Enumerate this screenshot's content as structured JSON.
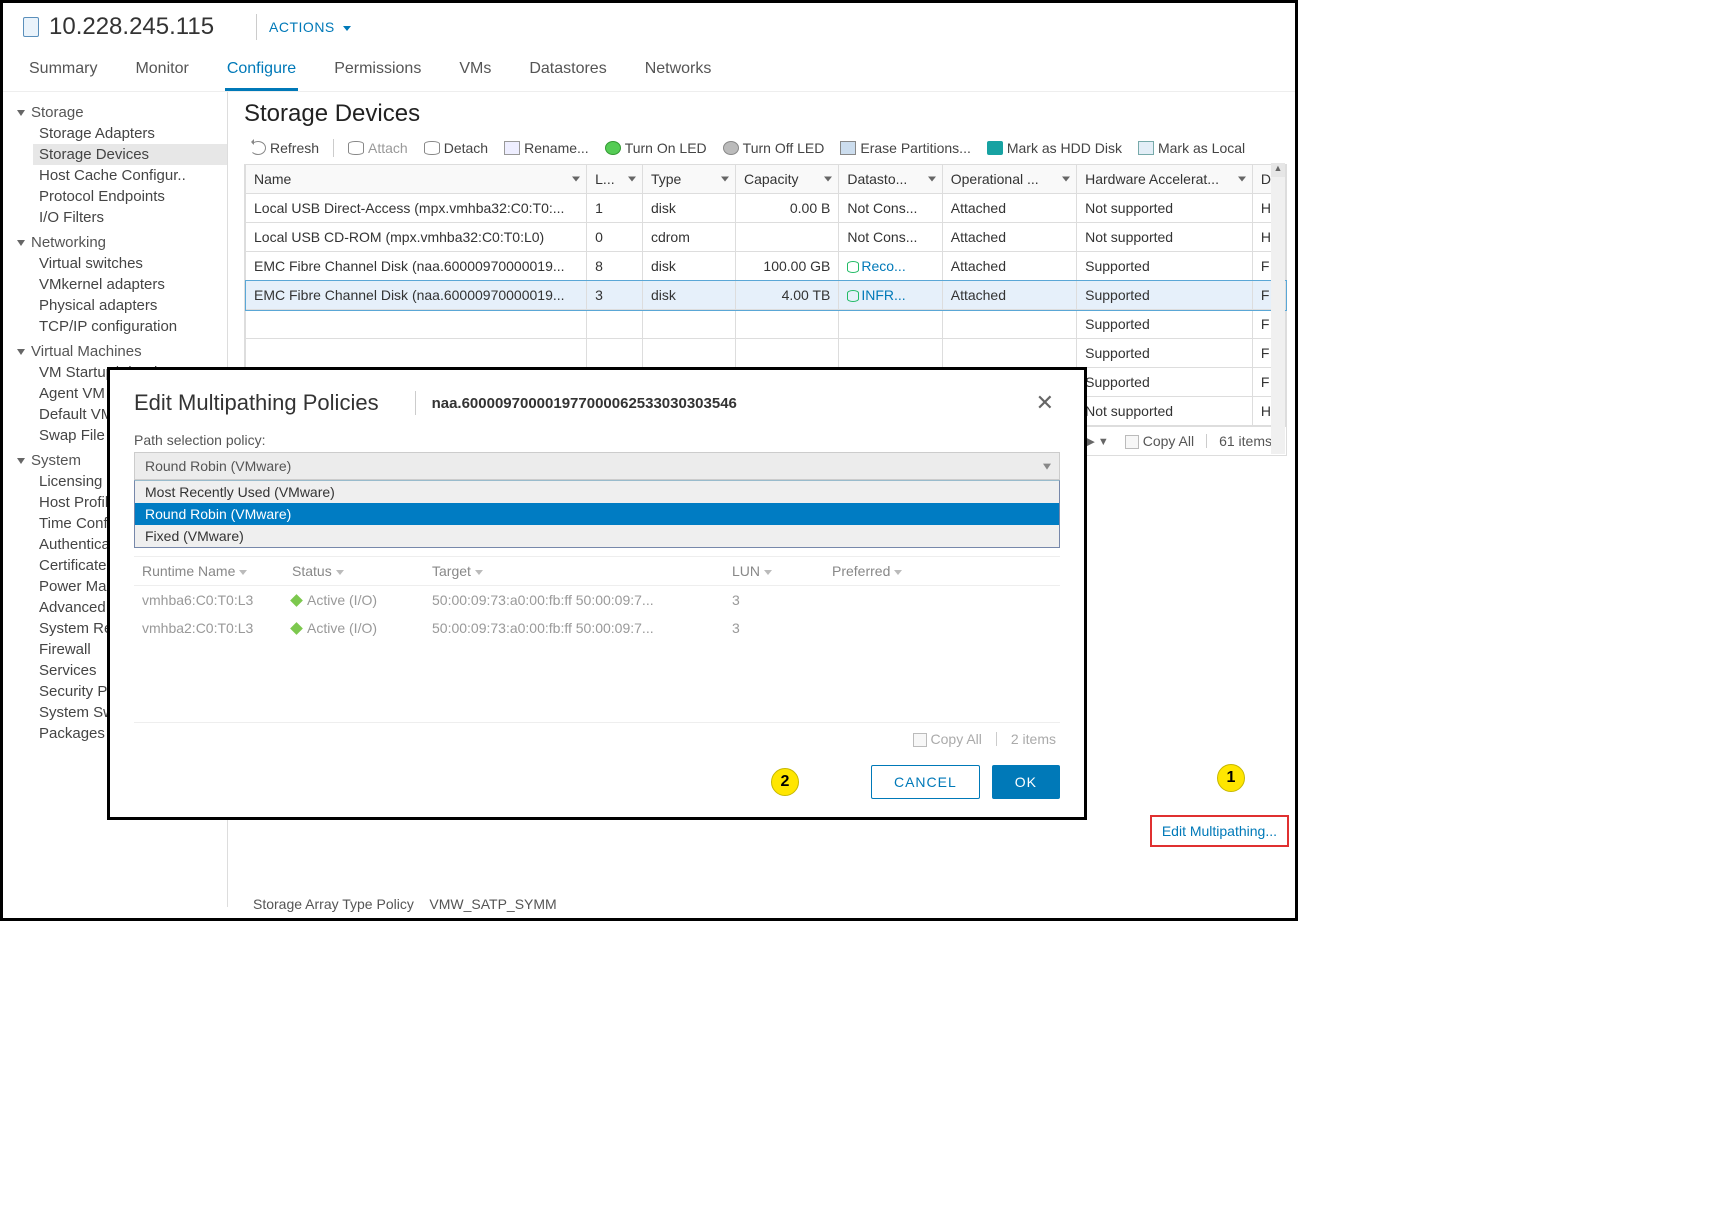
{
  "header": {
    "host_ip": "10.228.245.115",
    "actions_label": "ACTIONS"
  },
  "tabs": [
    "Summary",
    "Monitor",
    "Configure",
    "Permissions",
    "VMs",
    "Datastores",
    "Networks"
  ],
  "active_tab": "Configure",
  "sidebar": {
    "groups": [
      {
        "label": "Storage",
        "items": [
          "Storage Adapters",
          "Storage Devices",
          "Host Cache Configur..",
          "Protocol Endpoints",
          "I/O Filters"
        ],
        "selected": "Storage Devices"
      },
      {
        "label": "Networking",
        "items": [
          "Virtual switches",
          "VMkernel adapters",
          "Physical adapters",
          "TCP/IP configuration"
        ]
      },
      {
        "label": "Virtual Machines",
        "items": [
          "VM Startup/Shutdown",
          "Agent VM Settings",
          "Default VM Compati..",
          "Swap File Location"
        ]
      },
      {
        "label": "System",
        "items": [
          "Licensing",
          "Host Profile",
          "Time Configuration",
          "Authentication Servi..",
          "Certificate",
          "Power Management",
          "Advanced System S..",
          "System Resource Re..",
          "Firewall",
          "Services",
          "Security Profile",
          "System Swap",
          "Packages"
        ]
      }
    ]
  },
  "main": {
    "title": "Storage Devices",
    "toolbar": {
      "refresh": "Refresh",
      "attach": "Attach",
      "detach": "Detach",
      "rename": "Rename...",
      "led_on": "Turn On LED",
      "led_off": "Turn Off LED",
      "erase": "Erase Partitions...",
      "hdd": "Mark as HDD Disk",
      "local": "Mark as Local"
    },
    "columns": [
      "Name",
      "L...",
      "Type",
      "Capacity",
      "Datasto...",
      "Operational ...",
      "Hardware Accelerat...",
      "Dr"
    ],
    "rows": [
      {
        "name": "Local USB Direct-Access (mpx.vmhba32:C0:T0:...",
        "lun": "1",
        "type": "disk",
        "cap": "0.00 B",
        "ds": "Not Cons...",
        "ds_link": false,
        "op": "Attached",
        "hw": "Not supported",
        "dr": "H"
      },
      {
        "name": "Local USB CD-ROM (mpx.vmhba32:C0:T0:L0)",
        "lun": "0",
        "type": "cdrom",
        "cap": "",
        "ds": "Not Cons...",
        "ds_link": false,
        "op": "Attached",
        "hw": "Not supported",
        "dr": "H"
      },
      {
        "name": "EMC Fibre Channel Disk (naa.60000970000019...",
        "lun": "8",
        "type": "disk",
        "cap": "100.00 GB",
        "ds": "Reco...",
        "ds_link": true,
        "op": "Attached",
        "hw": "Supported",
        "dr": "F"
      },
      {
        "name": "EMC Fibre Channel Disk (naa.60000970000019...",
        "lun": "3",
        "type": "disk",
        "cap": "4.00 TB",
        "ds": "INFR...",
        "ds_link": true,
        "op": "Attached",
        "hw": "Supported",
        "dr": "F",
        "selected": true
      },
      {
        "name": "",
        "lun": "",
        "type": "",
        "cap": "",
        "ds": "",
        "ds_link": false,
        "op": "",
        "hw": "Supported",
        "dr": "F"
      },
      {
        "name": "",
        "lun": "",
        "type": "",
        "cap": "",
        "ds": "",
        "ds_link": false,
        "op": "",
        "hw": "Supported",
        "dr": "F"
      },
      {
        "name": "",
        "lun": "",
        "type": "",
        "cap": "",
        "ds": "",
        "ds_link": false,
        "op": "",
        "hw": "Supported",
        "dr": "F"
      },
      {
        "name": "",
        "lun": "",
        "type": "",
        "cap": "",
        "ds": "",
        "ds_link": false,
        "op": "",
        "hw": "Not supported",
        "dr": "H"
      }
    ],
    "footer": {
      "copy_all": "Copy All",
      "items": "61 items"
    },
    "edit_mp": "Edit Multipathing...",
    "policy_label": "Storage Array Type Policy",
    "policy_value": "VMW_SATP_SYMM"
  },
  "modal": {
    "title": "Edit Multipathing Policies",
    "device_id": "naa.600009700001977000062533030303546",
    "form_label": "Path selection policy:",
    "current": "Round Robin (VMware)",
    "options": [
      "Most Recently Used (VMware)",
      "Round Robin (VMware)",
      "Fixed (VMware)"
    ],
    "highlight": "Round Robin (VMware)",
    "path_cols": [
      "Runtime Name",
      "Status",
      "Target",
      "LUN",
      "Preferred"
    ],
    "paths": [
      {
        "runtime": "vmhba6:C0:T0:L3",
        "status": "Active (I/O)",
        "target": "50:00:09:73:a0:00:fb:ff 50:00:09:7...",
        "lun": "3",
        "pref": ""
      },
      {
        "runtime": "vmhba2:C0:T0:L3",
        "status": "Active (I/O)",
        "target": "50:00:09:73:a0:00:fb:ff 50:00:09:7...",
        "lun": "3",
        "pref": ""
      }
    ],
    "footer": {
      "copy_all": "Copy All",
      "items": "2 items"
    },
    "btn_cancel": "CANCEL",
    "btn_ok": "OK"
  },
  "annotations": {
    "a1": "1",
    "a2": "2"
  }
}
